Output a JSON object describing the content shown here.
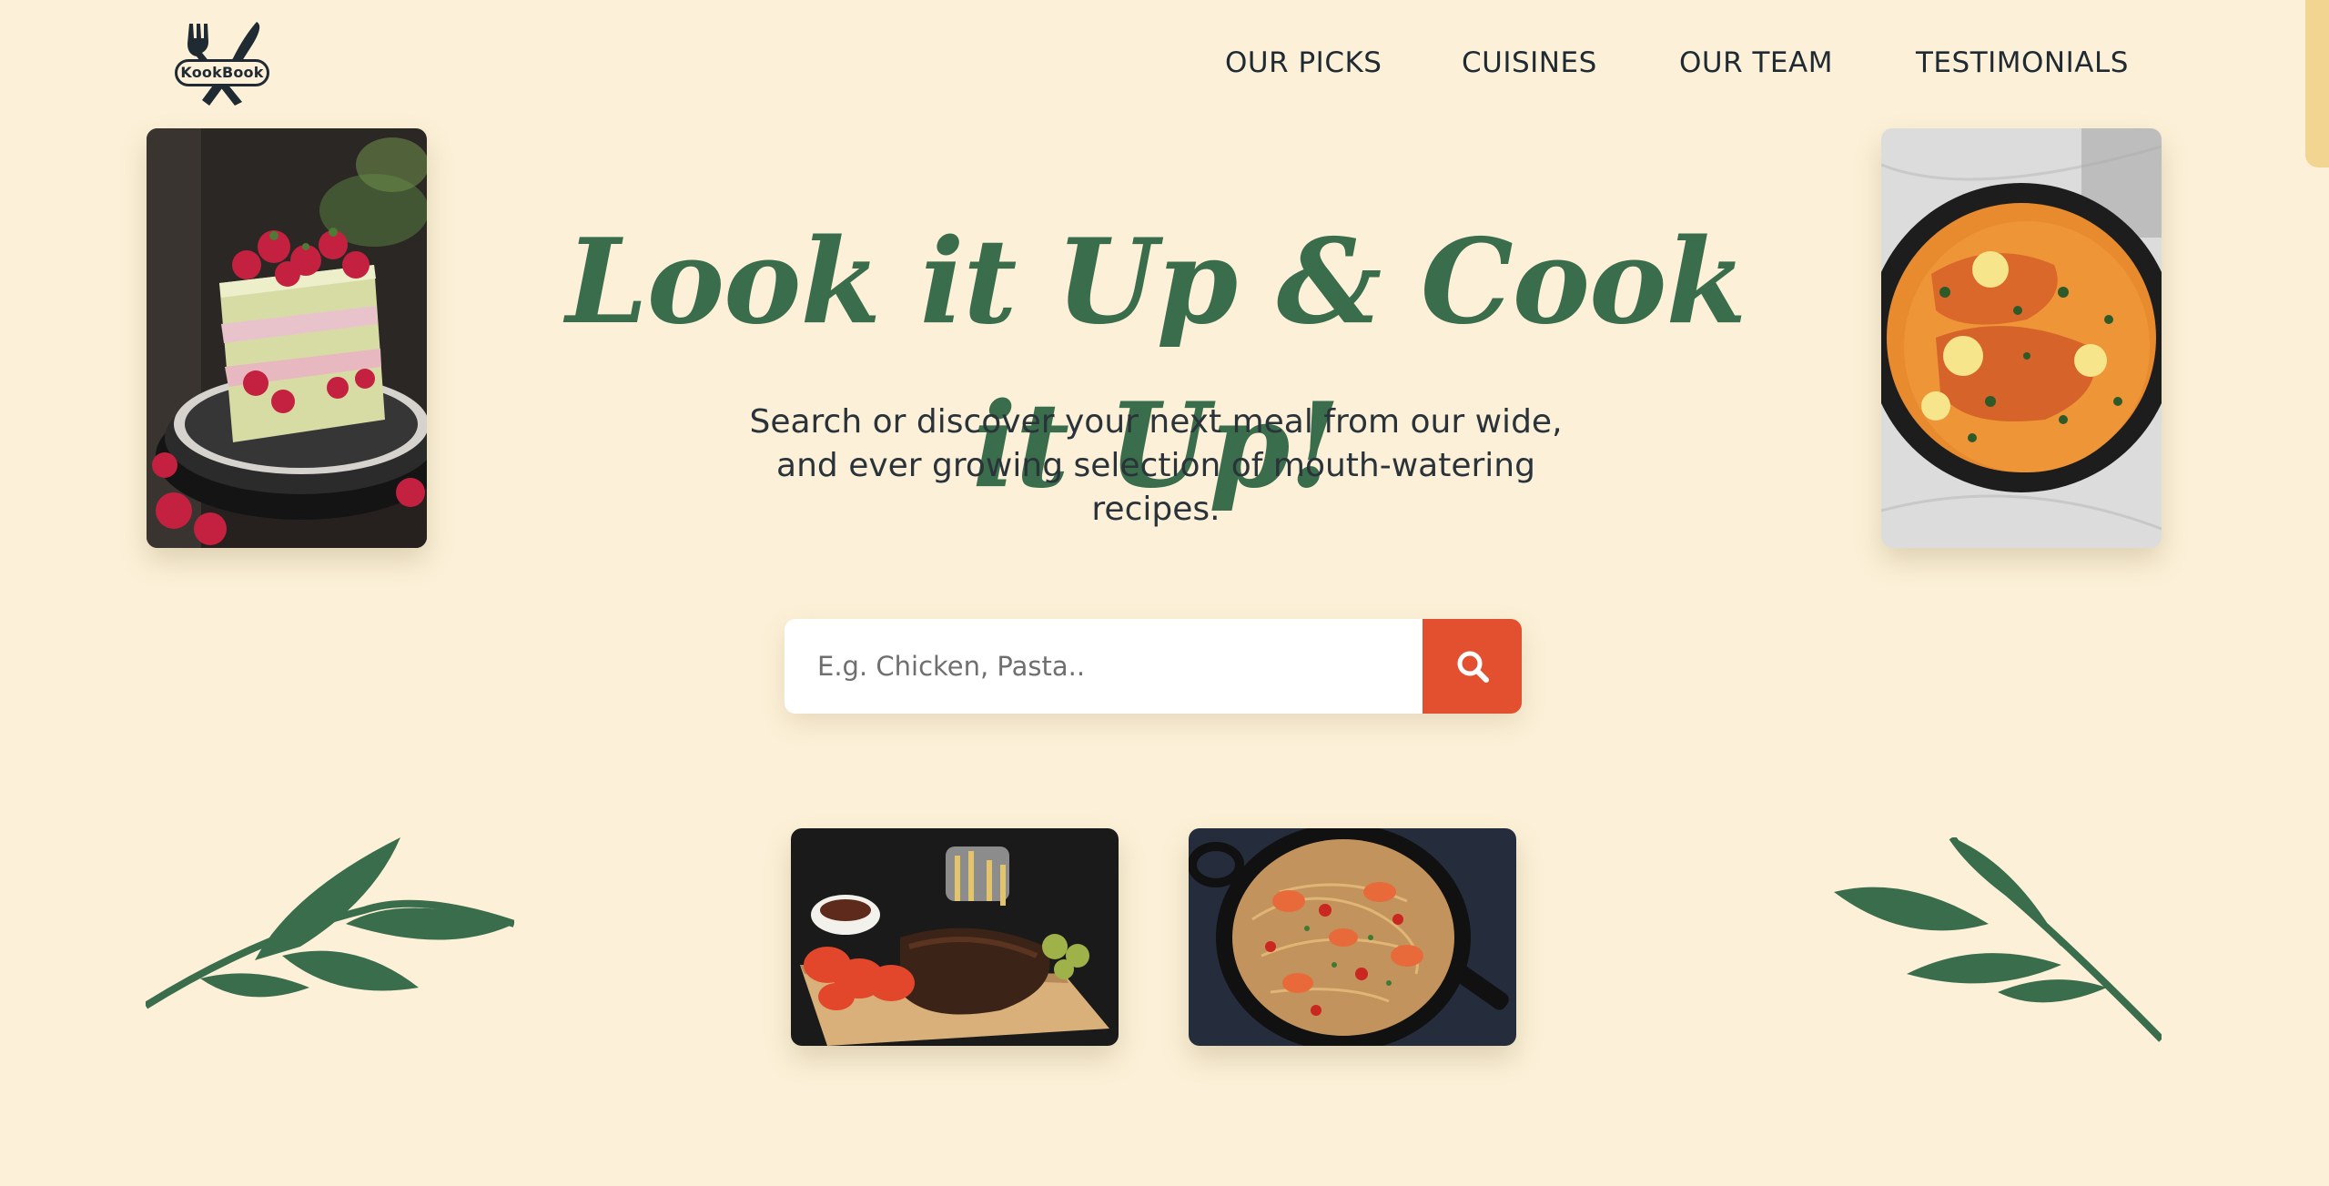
{
  "brand": {
    "logo_text": "KookBook",
    "icon": "fork-knife-icon"
  },
  "nav": {
    "items": [
      {
        "label": "OUR PICKS"
      },
      {
        "label": "CUISINES"
      },
      {
        "label": "OUR TEAM"
      },
      {
        "label": "TESTIMONIALS"
      }
    ]
  },
  "hero": {
    "title": "Look it Up & Cook it Up!",
    "subtitle_lines": [
      "Search or discover your next meal from our wide,",
      "and ever growing selection of mouth-watering",
      "recipes."
    ]
  },
  "search": {
    "value": "",
    "placeholder": "E.g. Chicken, Pasta..",
    "button_icon": "search-icon"
  },
  "images": [
    {
      "name": "raspberry-layer-cake"
    },
    {
      "name": "salmon-curry-pan"
    },
    {
      "name": "bbq-ribs-platter"
    },
    {
      "name": "shrimp-spaghetti-pan"
    }
  ],
  "colors": {
    "background": "#fcf1d8",
    "accent_green": "#3a6d4b",
    "search_button": "#e3502f",
    "text_dark": "#1f2a33",
    "scrollbar": "#f3d592"
  }
}
